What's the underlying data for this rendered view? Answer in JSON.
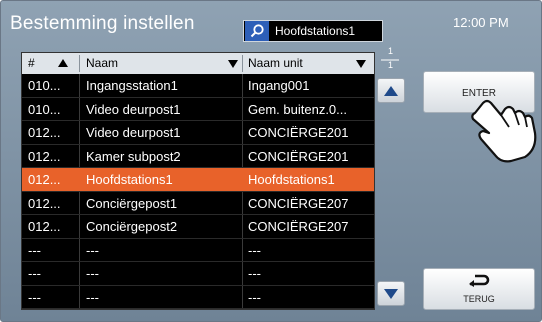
{
  "title": "Bestemming instellen",
  "search": {
    "value": "Hoofdstations1",
    "icon": "search-icon"
  },
  "clock": "12:00 PM",
  "table": {
    "columns": [
      "#",
      "Naam",
      "Naam unit"
    ],
    "rows": [
      {
        "num": "010...",
        "naam": "Ingangsstation1",
        "unit": "Ingang001"
      },
      {
        "num": "010...",
        "naam": "Video deurpost1",
        "unit": "Gem. buitenz.0..."
      },
      {
        "num": "012...",
        "naam": "Video deurpost1",
        "unit": "CONCIËRGE201"
      },
      {
        "num": "012...",
        "naam": "Kamer subpost2",
        "unit": "CONCIËRGE201"
      },
      {
        "num": "012...",
        "naam": "Hoofdstations1",
        "unit": "Hoofdstations1"
      },
      {
        "num": "012...",
        "naam": "Conciërgepost1",
        "unit": "CONCIËRGE207"
      },
      {
        "num": "012...",
        "naam": "Conciërgepost2",
        "unit": "CONCIËRGE207"
      },
      {
        "num": "---",
        "naam": "---",
        "unit": "---"
      },
      {
        "num": "---",
        "naam": "---",
        "unit": "---"
      },
      {
        "num": "---",
        "naam": "---",
        "unit": "---"
      }
    ],
    "selected_index": 4
  },
  "pager": {
    "current": "1",
    "total": "1"
  },
  "buttons": {
    "enter": "ENTER",
    "back": "TERUG"
  },
  "colors": {
    "selected_row": "#e8622a",
    "search_icon_bg": "#2d5fb8"
  }
}
